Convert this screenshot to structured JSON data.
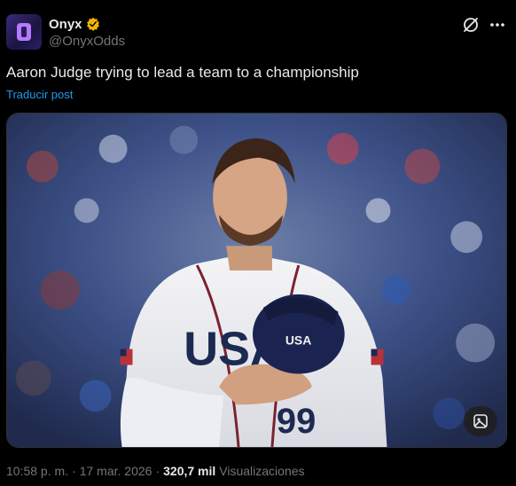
{
  "author": {
    "display_name": "Onyx",
    "handle": "@OnyxOdds",
    "verified": true,
    "badge_color": "#f4b400"
  },
  "post": {
    "text": "Aaron Judge trying to lead a team to a championship",
    "translate_label": "Traducir post"
  },
  "media": {
    "jersey_text": "USA",
    "jersey_number": "99",
    "cap_logo": "USA"
  },
  "meta": {
    "time": "10:58 p. m.",
    "separator": "·",
    "date": "17 mar. 2026",
    "separator2": "·",
    "views_count": "320,7 mil",
    "views_label": "Visualizaciones"
  },
  "icons": {
    "grok": "grok-icon",
    "more": "more-icon",
    "alt": "image-alt-icon"
  },
  "colors": {
    "link": "#1d9bf0",
    "secondary_text": "#71767b",
    "primary_text": "#e7e9ea"
  }
}
